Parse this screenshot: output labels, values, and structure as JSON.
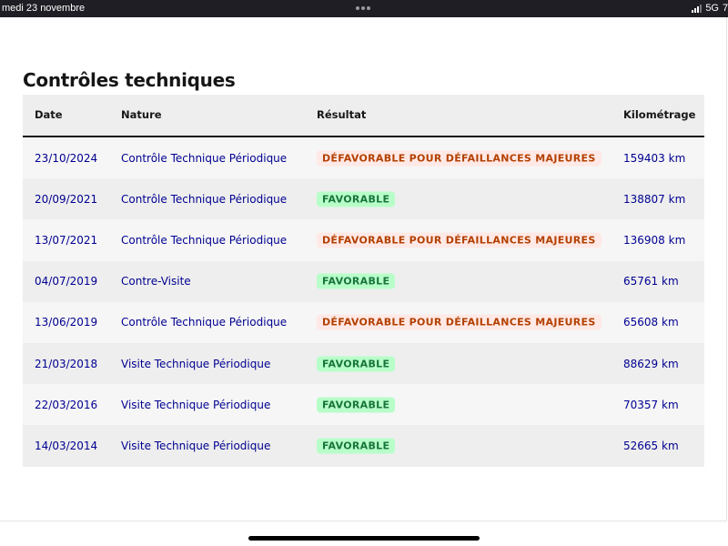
{
  "status_bar": {
    "date": "medi 23 novembre",
    "network": "5G",
    "battery": "7"
  },
  "page": {
    "title": "Contrôles techniques"
  },
  "table": {
    "headers": {
      "date": "Date",
      "nature": "Nature",
      "result": "Résultat",
      "km": "Kilométrage"
    },
    "rows": [
      {
        "date": "23/10/2024",
        "nature": "Contrôle Technique Périodique",
        "result": "DÉFAVORABLE POUR DÉFAILLANCES MAJEURES",
        "km": "159403 km"
      },
      {
        "date": "20/09/2021",
        "nature": "Contrôle Technique Périodique",
        "result": "FAVORABLE",
        "km": "138807 km"
      },
      {
        "date": "13/07/2021",
        "nature": "Contrôle Technique Périodique",
        "result": "DÉFAVORABLE POUR DÉFAILLANCES MAJEURES",
        "km": "136908 km"
      },
      {
        "date": "04/07/2019",
        "nature": "Contre-Visite",
        "result": "FAVORABLE",
        "km": "65761 km"
      },
      {
        "date": "13/06/2019",
        "nature": "Contrôle Technique Périodique",
        "result": "DÉFAVORABLE POUR DÉFAILLANCES MAJEURES",
        "km": "65608 km"
      },
      {
        "date": "21/03/2018",
        "nature": "Visite Technique Périodique",
        "result": "FAVORABLE",
        "km": "88629 km"
      },
      {
        "date": "22/03/2016",
        "nature": "Visite Technique Périodique",
        "result": "FAVORABLE",
        "km": "70357 km"
      },
      {
        "date": "14/03/2014",
        "nature": "Visite Technique Périodique",
        "result": "FAVORABLE",
        "km": "52665 km"
      }
    ]
  },
  "colors": {
    "link_text": "#000091",
    "unfavorable_bg": "#ffe9e6",
    "unfavorable_text": "#b34000",
    "favorable_bg": "#b8fec9",
    "favorable_text": "#18753c"
  }
}
